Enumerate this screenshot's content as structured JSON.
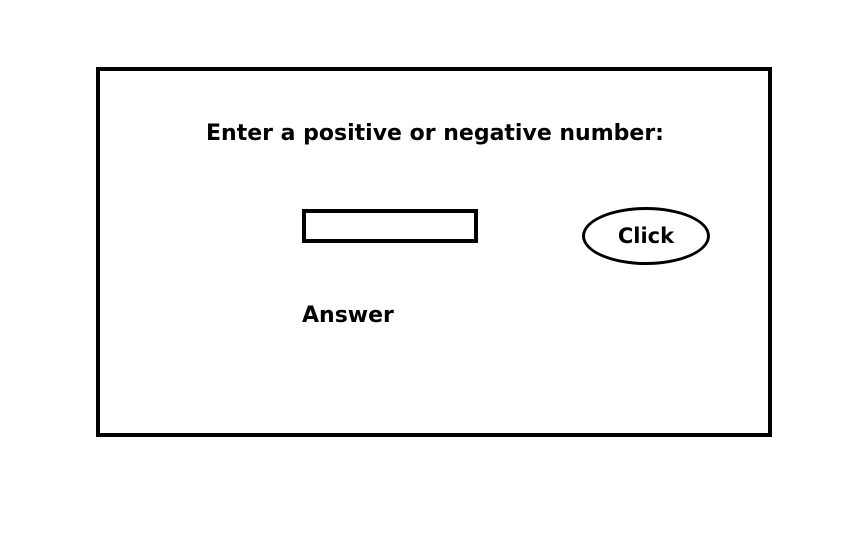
{
  "form": {
    "prompt": "Enter a positive or negative number:",
    "input_value": "",
    "button_label": "Click",
    "answer_label": "Answer"
  },
  "colors": {
    "border": "#000000",
    "background": "#ffffff",
    "text": "#000000"
  }
}
